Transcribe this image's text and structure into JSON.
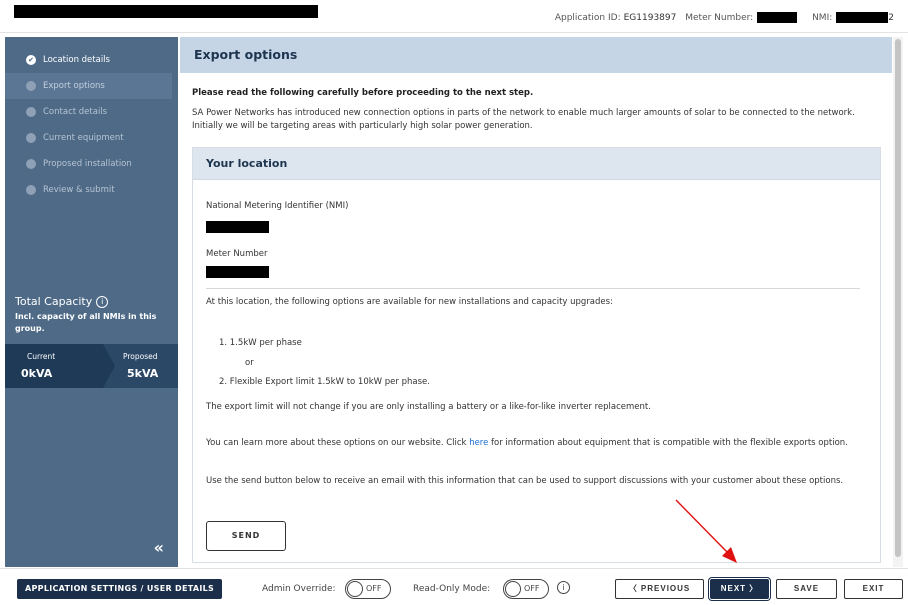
{
  "header": {
    "application_id_label": "Application ID:",
    "application_id": "EG1193897",
    "meter_number_label": "Meter Number:",
    "nmi_label": "NMI:",
    "nmi_suffix": "2"
  },
  "sidebar": {
    "check_glyph": "✔",
    "steps": [
      {
        "label": "Location details",
        "state": "done"
      },
      {
        "label": "Export options",
        "state": "active"
      },
      {
        "label": "Contact details",
        "state": "pending"
      },
      {
        "label": "Current equipment",
        "state": "pending"
      },
      {
        "label": "Proposed installation",
        "state": "pending"
      },
      {
        "label": "Review & submit",
        "state": "pending"
      }
    ],
    "capacity": {
      "title": "Total Capacity",
      "info_glyph": "i",
      "subtitle": "Incl. capacity of all NMIs in this group.",
      "current_label": "Current",
      "current_value": "0kVA",
      "proposed_label": "Proposed",
      "proposed_value": "5kVA"
    },
    "collapse_glyph": "«"
  },
  "main": {
    "title": "Export options",
    "intro_bold": "Please read the following carefully before proceeding to the next step.",
    "intro": "SA Power Networks has introduced new connection options in parts of the network to enable much larger amounts of solar to be connected to the network. Initially we will be targeting areas with particularly high solar power generation.",
    "location": {
      "title": "Your location",
      "nmi_label": "National Metering Identifier (NMI)",
      "meter_label": "Meter Number",
      "options_intro": "At this location, the following options are available for new installations and capacity upgrades:",
      "option1": "1. 1.5kW per phase",
      "or_text": "or",
      "option2": "2. Flexible Export limit 1.5kW to 10kW per phase.",
      "battery_note": "The export limit will not change if you are only installing a battery or a like-for-like inverter replacement.",
      "learn_pre": "You can learn more about these options on our website. Click ",
      "learn_link": "here",
      "learn_post": " for information about equipment that is compatible with the flexible exports option.",
      "send_note": "Use the send button below to receive an email with this information that can be used to support discussions with your customer about these options.",
      "send_label": "SEND"
    }
  },
  "footer": {
    "app_settings_label": "APPLICATION SETTINGS / USER DETAILS",
    "admin_override_label": "Admin Override:",
    "admin_override_value": "OFF",
    "readonly_label": "Read-Only Mode:",
    "readonly_value": "OFF",
    "info_glyph": "i",
    "previous_label": "〈  PREVIOUS",
    "next_label": "NEXT  〉",
    "save_label": "SAVE",
    "exit_label": "EXIT"
  },
  "colors": {
    "sidebar_bg": "#4e6a87",
    "header_band": "#c5d5e5",
    "primary_button": "#1b2f4a",
    "link": "#1a6fcf",
    "annotation_arrow": "#e01010"
  }
}
